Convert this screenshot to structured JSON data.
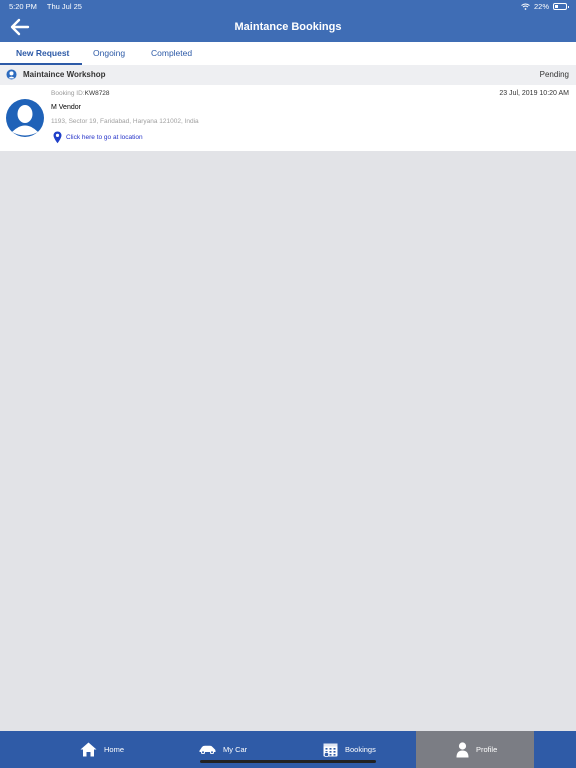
{
  "status_bar": {
    "time": "5:20 PM",
    "date": "Thu Jul 25",
    "battery": "22%"
  },
  "header": {
    "title": "Maintance Bookings"
  },
  "tabs": [
    {
      "label": "New Request",
      "active": true
    },
    {
      "label": "Ongoing",
      "active": false
    },
    {
      "label": "Completed",
      "active": false
    }
  ],
  "section": {
    "label": "Maintaince Workshop",
    "status": "Pending"
  },
  "booking": {
    "id_label": "Booking ID:",
    "id_value": "KW8728",
    "date": "23 Jul, 2019 10:20 AM",
    "vendor": "M Vendor",
    "address": "1193, Sector 19, Faridabad, Haryana 121002, India",
    "location_link": "Click here to go at location"
  },
  "bottom_nav": [
    {
      "label": "Home",
      "icon": "home-icon"
    },
    {
      "label": "My Car",
      "icon": "car-icon"
    },
    {
      "label": "Bookings",
      "icon": "calendar-icon"
    },
    {
      "label": "Profile",
      "icon": "person-icon",
      "active": true
    }
  ],
  "colors": {
    "primary": "#3f6db5",
    "nav": "#2f5ba7",
    "active_nav": "#7b7d84",
    "link": "#2432c8"
  }
}
